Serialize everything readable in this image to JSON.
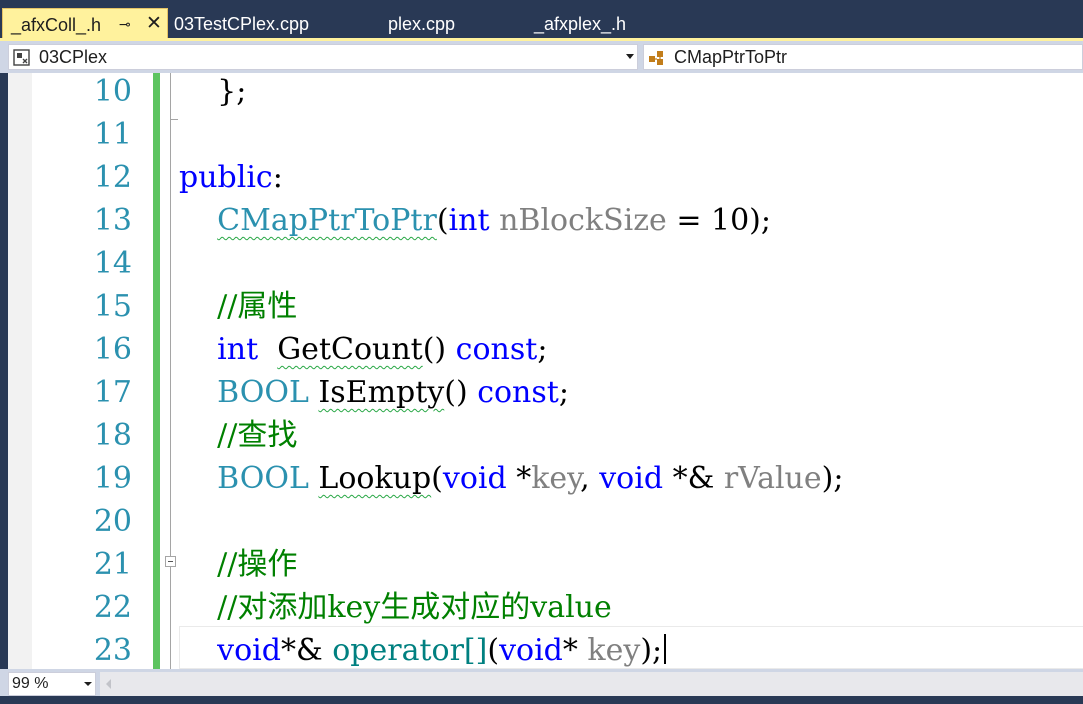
{
  "tabs": {
    "active": {
      "label": "_afxColl_.h",
      "pin": "⊸",
      "close": "✕"
    },
    "others": [
      "03TestCPlex.cpp",
      "plex.cpp",
      "_afxplex_.h"
    ]
  },
  "nav": {
    "project": "03CPlex",
    "member": "CMapPtrToPtr"
  },
  "zoom": "99 %",
  "lines": [
    {
      "num": "10",
      "tokens": [
        [
          "pl",
          "    };"
        ]
      ]
    },
    {
      "num": "11",
      "tokens": []
    },
    {
      "num": "12",
      "tokens": [
        [
          "kw",
          "public"
        ],
        [
          "pl",
          ":"
        ]
      ]
    },
    {
      "num": "13",
      "tokens": [
        [
          "pl",
          "    "
        ],
        [
          "ty sq",
          "CMapPtrToPtr"
        ],
        [
          "pl",
          "("
        ],
        [
          "kw",
          "int"
        ],
        [
          "pl",
          " "
        ],
        [
          "pm",
          "nBlockSize"
        ],
        [
          "pl",
          " = 10);"
        ]
      ]
    },
    {
      "num": "14",
      "tokens": []
    },
    {
      "num": "15",
      "tokens": [
        [
          "pl",
          "    "
        ],
        [
          "cm",
          "//属性"
        ]
      ]
    },
    {
      "num": "16",
      "tokens": [
        [
          "pl",
          "    "
        ],
        [
          "kw",
          "int"
        ],
        [
          "pl",
          "  "
        ],
        [
          "fn sq",
          "GetCount"
        ],
        [
          "pl",
          "() "
        ],
        [
          "kw",
          "const"
        ],
        [
          "pl",
          ";"
        ]
      ]
    },
    {
      "num": "17",
      "tokens": [
        [
          "pl",
          "    "
        ],
        [
          "ty",
          "BOOL"
        ],
        [
          "pl",
          " "
        ],
        [
          "fn sq",
          "IsEmpty"
        ],
        [
          "pl",
          "() "
        ],
        [
          "kw",
          "const"
        ],
        [
          "pl",
          ";"
        ]
      ]
    },
    {
      "num": "18",
      "tokens": [
        [
          "pl",
          "    "
        ],
        [
          "cm",
          "//查找"
        ]
      ]
    },
    {
      "num": "19",
      "tokens": [
        [
          "pl",
          "    "
        ],
        [
          "ty",
          "BOOL"
        ],
        [
          "pl",
          " "
        ],
        [
          "fn sq",
          "Lookup"
        ],
        [
          "pl",
          "("
        ],
        [
          "kw",
          "void"
        ],
        [
          "pl",
          " *"
        ],
        [
          "pm",
          "key"
        ],
        [
          "pl",
          ", "
        ],
        [
          "kw",
          "void"
        ],
        [
          "pl",
          " *& "
        ],
        [
          "pm",
          "rValue"
        ],
        [
          "pl",
          ");"
        ]
      ]
    },
    {
      "num": "20",
      "tokens": []
    },
    {
      "num": "21",
      "tokens": [
        [
          "pl",
          "    "
        ],
        [
          "cm",
          "//操作"
        ]
      ]
    },
    {
      "num": "22",
      "tokens": [
        [
          "pl",
          "    "
        ],
        [
          "cm",
          "//对添加key生成对应的value"
        ]
      ]
    },
    {
      "num": "23",
      "tokens": [
        [
          "pl",
          "    "
        ],
        [
          "kw",
          "void"
        ],
        [
          "pl",
          "*& "
        ],
        [
          "op",
          "operator[]"
        ],
        [
          "pl",
          "("
        ],
        [
          "kw",
          "void"
        ],
        [
          "pl",
          "* "
        ],
        [
          "pm",
          "key"
        ],
        [
          "pl",
          ");"
        ]
      ]
    }
  ],
  "colors": {
    "keyword": "#0000ff",
    "type": "#2b91af",
    "parameter": "#808080",
    "comment": "#008000",
    "operator": "#008080",
    "line_number": "#2b91af",
    "change_bar": "#5dc460",
    "active_tab": "#fff29d",
    "chrome": "#293955"
  },
  "icons": {
    "project_combo": "project-icon",
    "member_combo": "class-member-icon"
  }
}
